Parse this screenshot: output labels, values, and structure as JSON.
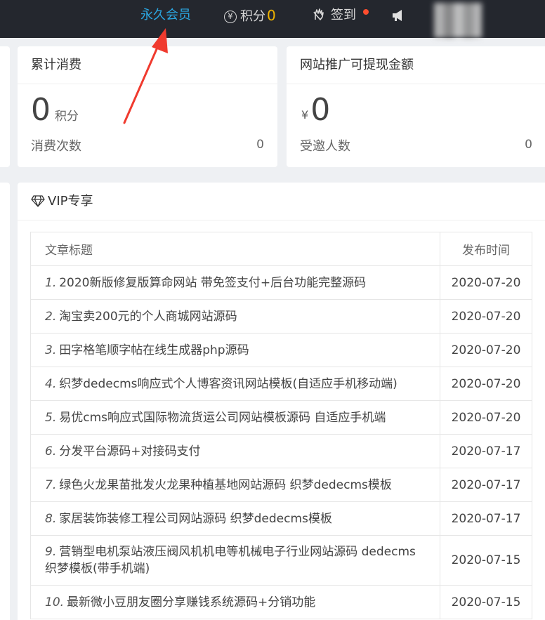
{
  "topbar": {
    "vip_label": "永久会员",
    "points_label": "积分",
    "points_value": "0",
    "signin_label": "签到"
  },
  "stats": {
    "consume": {
      "title": "累计消费",
      "amount": "0",
      "unit": "积分",
      "count_label": "消费次数",
      "count_value": "0"
    },
    "withdraw": {
      "title": "网站推广可提现金额",
      "currency": "¥",
      "amount": "0",
      "invite_label": "受邀人数",
      "invite_value": "0"
    }
  },
  "vip": {
    "title": "VIP专享",
    "columns": [
      "文章标题",
      "发布时间"
    ],
    "rows": [
      {
        "idx": "1.",
        "title": "2020新版修复版算命网站 带免签支付+后台功能完整源码",
        "date": "2020-07-20"
      },
      {
        "idx": "2.",
        "title": "淘宝卖200元的个人商城网站源码",
        "date": "2020-07-20"
      },
      {
        "idx": "3.",
        "title": "田字格笔顺字帖在线生成器php源码",
        "date": "2020-07-20"
      },
      {
        "idx": "4.",
        "title": "织梦dedecms响应式个人博客资讯网站模板(自适应手机移动端)",
        "date": "2020-07-20"
      },
      {
        "idx": "5.",
        "title": "易优cms响应式国际物流货运公司网站模板源码 自适应手机端",
        "date": "2020-07-20"
      },
      {
        "idx": "6.",
        "title": "分发平台源码+对接码支付",
        "date": "2020-07-17"
      },
      {
        "idx": "7.",
        "title": "绿色火龙果苗批发火龙果种植基地网站源码 织梦dedecms模板",
        "date": "2020-07-17"
      },
      {
        "idx": "8.",
        "title": "家居装饰装修工程公司网站源码 织梦dedecms模板",
        "date": "2020-07-17"
      },
      {
        "idx": "9.",
        "title": "营销型电机泵站液压阀风机机电等机械电子行业网站源码 dedecms织梦模板(带手机端)",
        "date": "2020-07-15"
      },
      {
        "idx": "10.",
        "title": "最新微小豆朋友圈分享赚钱系统源码+分销功能",
        "date": "2020-07-15"
      }
    ]
  },
  "icons": {
    "points": "yen-circle-icon",
    "signin": "hand-icon",
    "notice": "megaphone-icon",
    "vip": "diamond-icon"
  },
  "colors": {
    "topbar_bg": "#24272e",
    "vip_link": "#2ba8e3",
    "points_value": "#f0b400",
    "notify_dot": "#ff4d2e",
    "annotation_arrow": "#f03a2e"
  }
}
